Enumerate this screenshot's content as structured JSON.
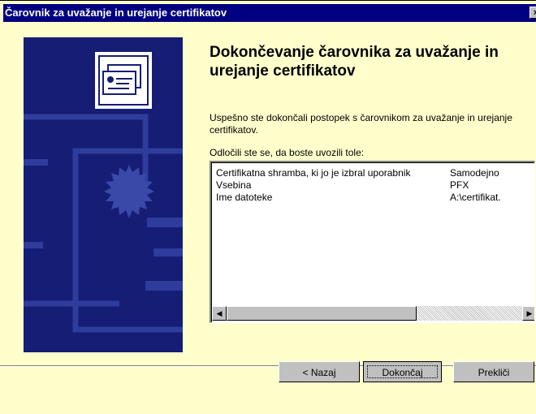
{
  "window": {
    "title": "Čarovnik za uvažanje in urejanje certifikatov",
    "close_glyph": "×"
  },
  "colors": {
    "face": "#ffffcc",
    "titlebar": "#000080",
    "banner": "#151d74"
  },
  "banner": {
    "icon": "certificate-icon"
  },
  "main": {
    "heading": "Dokončevanje čarovnika za uvažanje in urejanje certifikatov",
    "description": "Uspešno ste dokončali postopek s čarovnikom za uvažanje in urejanje certifikatov.",
    "summary_label": "Odločili ste se, da boste uvozili tole:"
  },
  "summary": {
    "rows": [
      {
        "name": "Certifikatna shramba, ki jo je izbral uporabnik",
        "value": "Samodejno"
      },
      {
        "name": "Vsebina",
        "value": "PFX"
      },
      {
        "name": "Ime datoteke",
        "value": "A:\\certifikat."
      }
    ]
  },
  "scrollbar": {
    "left_arrow": "◀",
    "right_arrow": "▶"
  },
  "buttons": {
    "back": "< Nazaj",
    "finish": "Dokončaj",
    "cancel": "Prekliči"
  }
}
